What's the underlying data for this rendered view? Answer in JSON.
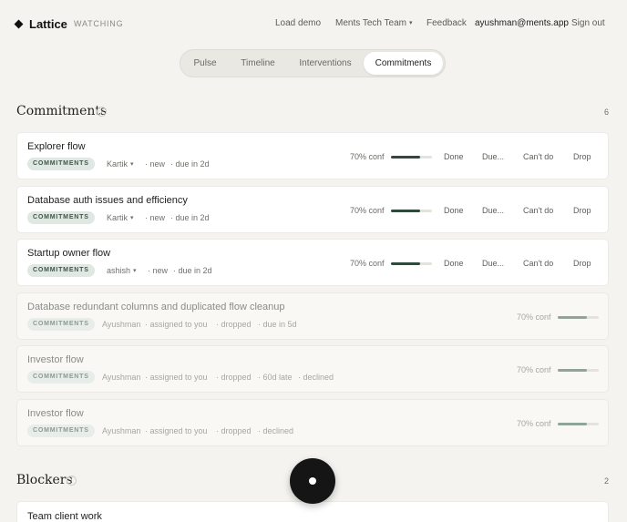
{
  "app": {
    "name": "Lattice",
    "status": "WATCHING"
  },
  "nav": {
    "load_demo": "Load demo",
    "team": "Ments Tech Team",
    "feedback": "Feedback",
    "user": "ayushman@ments.app",
    "sign_out": "Sign out"
  },
  "tabs": [
    "Pulse",
    "Timeline",
    "Interventions",
    "Commitments"
  ],
  "active_tab": "Commitments",
  "commitments": {
    "title": "Commitments",
    "info": "i",
    "count": "6",
    "actions": [
      "Done",
      "Due...",
      "Can't do",
      "Drop"
    ],
    "items": [
      {
        "title": "Explorer flow",
        "badge": "COMMITMENTS",
        "owner": "Kartik",
        "status": "new",
        "due": "due in 2d",
        "conf": "70% conf",
        "conf_value": 0.7
      },
      {
        "title": "Database auth issues and efficiency",
        "badge": "COMMITMENTS",
        "owner": "Kartik",
        "status": "new",
        "due": "due in 2d",
        "conf": "70% conf",
        "conf_value": 0.7
      },
      {
        "title": "Startup owner flow",
        "badge": "COMMITMENTS",
        "owner": "ashish",
        "status": "new",
        "due": "due in 2d",
        "conf": "70% conf",
        "conf_value": 0.7
      },
      {
        "title": "Database redundant columns and duplicated flow cleanup",
        "badge": "COMMITMENTS",
        "owner": "Ayushman",
        "assigned": "assigned to you",
        "status": "dropped",
        "due": "due in 5d",
        "conf": "70% conf",
        "conf_value": 0.7
      },
      {
        "title": "Investor flow",
        "badge": "COMMITMENTS",
        "owner": "Ayushman",
        "assigned": "assigned to you",
        "status": "dropped",
        "due": "60d late",
        "extra": "declined",
        "conf": "70% conf",
        "conf_value": 0.7
      },
      {
        "title": "Investor flow",
        "badge": "COMMITMENTS",
        "owner": "Ayushman",
        "assigned": "assigned to you",
        "status": "dropped",
        "extra": "declined",
        "conf": "70% conf",
        "conf_value": 0.7
      }
    ]
  },
  "blockers": {
    "title": "Blockers",
    "info": "i",
    "count": "2",
    "items": [
      {
        "title": "Team client work"
      }
    ]
  },
  "colors": {
    "accent": "#2f4a3d",
    "badge_bg": "#dfe8e2",
    "background": "#f4f3ef"
  },
  "icons": {
    "brand": "diamond-icon",
    "fab": "record-dot-icon"
  }
}
